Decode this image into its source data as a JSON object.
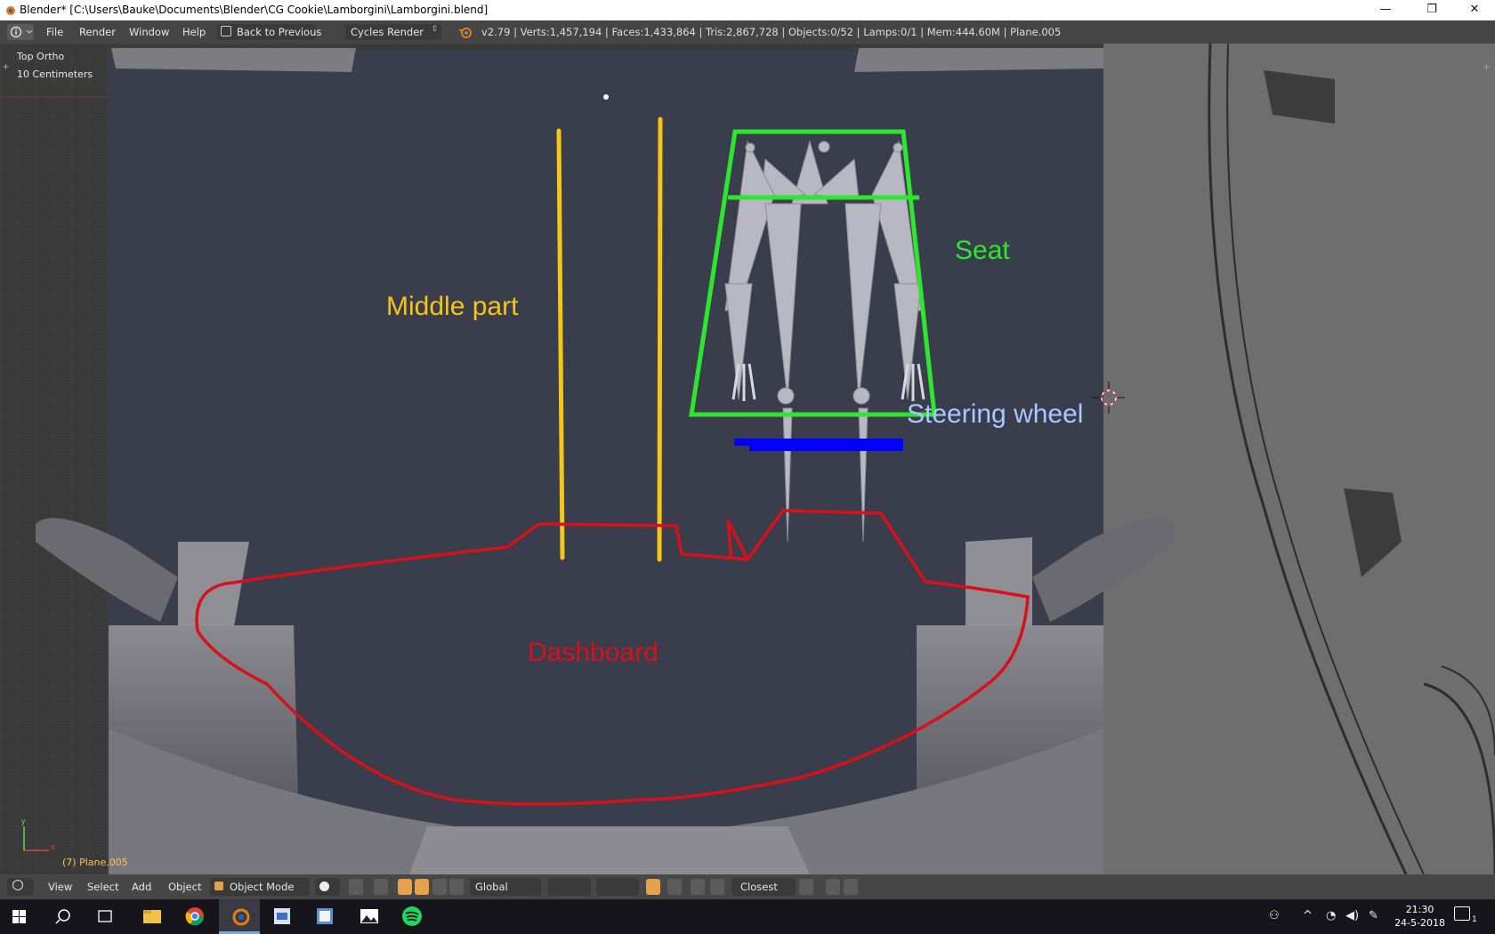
{
  "window": {
    "title": "Blender* [C:\\Users\\Bauke\\Documents\\Blender\\CG Cookie\\Lamborgini\\Lamborgini.blend]",
    "controls": [
      "—",
      "❐",
      "✕"
    ]
  },
  "menubar": {
    "menus": [
      "File",
      "Render",
      "Window",
      "Help"
    ],
    "back_label": "Back to Previous",
    "render_engine": "Cycles Render",
    "stats": "v2.79 | Verts:1,457,194 | Faces:1,433,864 | Tris:2,867,728 | Objects:0/52 | Lamps:0/1 | Mem:444.60M | Plane.005"
  },
  "viewport": {
    "view_name": "Top Ortho",
    "scale": "10 Centimeters",
    "active_object": "(7) Plane.005",
    "axis_x": "x",
    "axis_y": "y",
    "annotations": {
      "middle": "Middle part",
      "seat": "Seat",
      "steering": "Steering wheel",
      "dashboard": "Dashboard"
    },
    "colors": {
      "middle": "#f5c518",
      "seat": "#2ee62e",
      "steering": "#0000ff",
      "steering_text": "#a8c8ff",
      "dashboard": "#d8101a"
    }
  },
  "header3d": {
    "menus": [
      "View",
      "Select",
      "Add",
      "Object"
    ],
    "mode": "Object Mode",
    "orientation": "Global",
    "snap_target": "Closest"
  },
  "taskbar": {
    "time": "21:30",
    "date": "24-5-2018",
    "notification_count": "1"
  }
}
